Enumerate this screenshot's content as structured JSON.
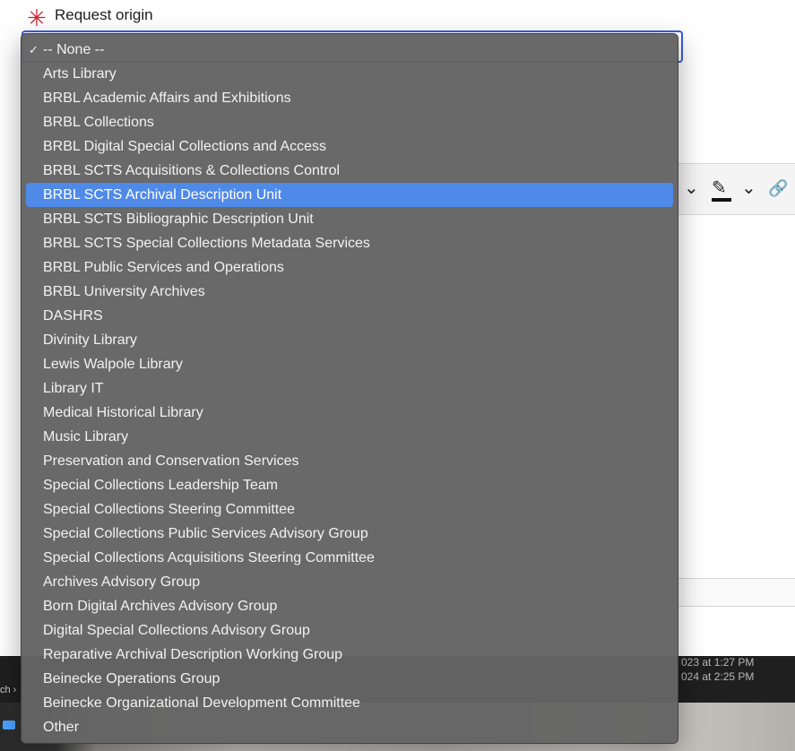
{
  "field": {
    "required_mark": "✳",
    "label": "Request origin"
  },
  "dropdown": {
    "checked_option_index": 0,
    "highlighted_option_index": 6,
    "check_glyph": "✓",
    "options": [
      "-- None --",
      "Arts Library",
      "BRBL Academic Affairs and Exhibitions",
      "BRBL Collections",
      "BRBL Digital Special Collections and Access",
      "BRBL SCTS Acquisitions & Collections Control",
      "BRBL SCTS Archival Description Unit",
      "BRBL SCTS Bibliographic Description Unit",
      "BRBL SCTS Special Collections Metadata Services",
      "BRBL Public Services and Operations",
      "BRBL University Archives",
      "DASHRS",
      "Divinity Library",
      "Lewis Walpole Library",
      "Library IT",
      "Medical Historical Library",
      "Music Library",
      "Preservation and Conservation Services",
      "Special Collections Leadership Team",
      "Special Collections Steering Committee",
      "Special Collections Public Services Advisory Group",
      "Special Collections Acquisitions Steering Committee",
      "Archives Advisory Group",
      "Born Digital Archives Advisory Group",
      "Digital Special Collections Advisory Group",
      "Reparative Archival Description Working Group",
      "Beinecke Operations Group",
      "Beinecke Organizational Development Committee",
      "Other"
    ]
  },
  "toolbar": {
    "chevron1": "⌄",
    "highlight_glyph": "✎",
    "chevron2": "⌄",
    "link_glyph": "🔗"
  },
  "background": {
    "finder_path": "ch ›",
    "timestamp1": "023 at 1:27 PM",
    "timestamp2": "024 at 2:25 PM"
  },
  "colors": {
    "accent": "#3d5ce0",
    "highlight": "#4f8ae8",
    "required": "#d0222e"
  }
}
